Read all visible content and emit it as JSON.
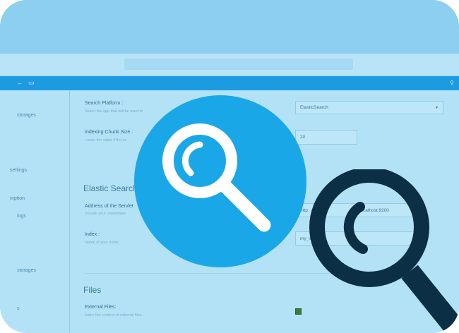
{
  "toolbar": {
    "left_icons": [
      "back-arrow-icon",
      "monitor-icon"
    ],
    "right_icon": "search-icon"
  },
  "sidebar": {
    "items": [
      "storages",
      "settings",
      "mption",
      "ings",
      "storages",
      "s"
    ]
  },
  "form": {
    "search_platform": {
      "label": "Search Platform :",
      "help": "Select the app that will be used to",
      "value": "ElasticSearch"
    },
    "chunk_size": {
      "label": "Indexing Chunk Size :",
      "help": "Lower the value if the se",
      "value": "20"
    },
    "elastic_section": "Elastic Search",
    "server_address": {
      "label": "Address of the Servlet",
      "help": "Include your credentials",
      "value_start": "http",
      "value_end": "localhost:9200"
    },
    "index": {
      "label": "Index :",
      "help": "Name of your index.",
      "value": "my_in"
    },
    "files_section": "Files",
    "external_files": {
      "label": "External Files:",
      "help": "Index the content of external files."
    }
  },
  "colors": {
    "toolbar": "#1d9be0",
    "circle": "#1aa7e8",
    "dark_magnifier": "#0b2f44"
  }
}
